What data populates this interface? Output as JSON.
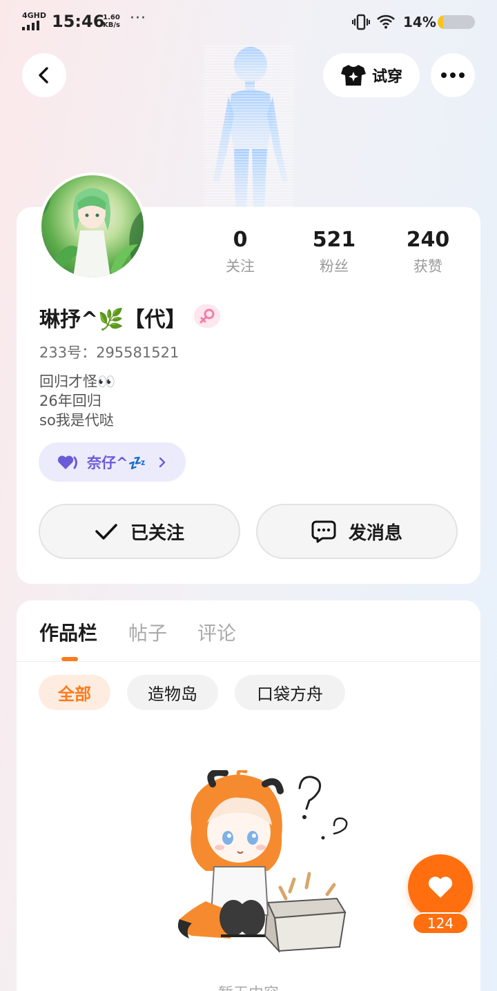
{
  "status_bar": {
    "network": "4GHD",
    "time": "15:46",
    "speed_value": "1.60",
    "speed_unit": "KB/s",
    "overflow": "···",
    "battery_text": "14%",
    "battery_level": 0.14
  },
  "header": {
    "back_icon": "chevron-left-icon",
    "tryon_label": "试穿",
    "tryon_icon": "tshirt-sparkle-icon",
    "more_icon": "more-horizontal-icon"
  },
  "profile": {
    "stats": [
      {
        "value": "0",
        "label": "关注"
      },
      {
        "value": "521",
        "label": "粉丝"
      },
      {
        "value": "240",
        "label": "获赞"
      }
    ],
    "username": "琳抒^🌿【代】",
    "gender_icon": "female-icon",
    "uid": "233号：295581521",
    "bio_lines": [
      "回归才怪👀",
      "26年回归",
      "so我是代哒"
    ],
    "guild_label": "奈仔^💤",
    "follow_label": "已关注",
    "message_label": "发消息"
  },
  "content": {
    "tabs": [
      "作品栏",
      "帖子",
      "评论"
    ],
    "active_tab": 0,
    "chips": [
      "全部",
      "造物岛",
      "口袋方舟"
    ],
    "active_chip": 0,
    "empty_text": "暂无内容"
  },
  "fab": {
    "count": "124"
  },
  "colors": {
    "accent": "#ff7a1a",
    "guild": "#6a5bd8",
    "gender": "#f48fb1"
  }
}
